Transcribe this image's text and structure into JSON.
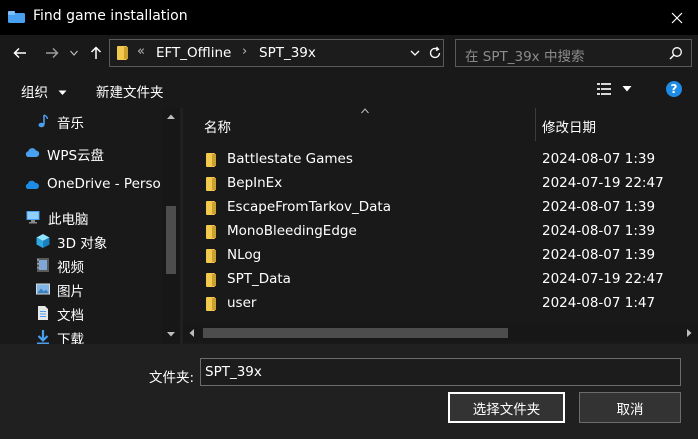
{
  "window": {
    "title": "Find game installation"
  },
  "address": {
    "overflow": "«",
    "segments": [
      "EFT_Offline",
      "SPT_39x"
    ]
  },
  "search": {
    "placeholder": "在 SPT_39x 中搜索"
  },
  "toolbar": {
    "organize": "组织",
    "new_folder": "新建文件夹"
  },
  "sidebar": {
    "items": [
      {
        "label": "音乐",
        "icon": "music-icon"
      },
      {
        "label": "WPS云盘",
        "icon": "cloud-icon"
      },
      {
        "label": "OneDrive - Perso",
        "icon": "onedrive-icon"
      },
      {
        "label": "此电脑",
        "icon": "computer-icon"
      },
      {
        "label": "3D 对象",
        "icon": "cube-icon"
      },
      {
        "label": "视频",
        "icon": "video-icon"
      },
      {
        "label": "图片",
        "icon": "picture-icon"
      },
      {
        "label": "文档",
        "icon": "document-icon"
      },
      {
        "label": "下载",
        "icon": "download-icon"
      }
    ]
  },
  "columns": {
    "name": "名称",
    "modified": "修改日期"
  },
  "files": [
    {
      "name": "Battlestate Games",
      "modified": "2024-08-07 1:39"
    },
    {
      "name": "BepInEx",
      "modified": "2024-07-19 22:47"
    },
    {
      "name": "EscapeFromTarkov_Data",
      "modified": "2024-08-07 1:39"
    },
    {
      "name": "MonoBleedingEdge",
      "modified": "2024-08-07 1:39"
    },
    {
      "name": "NLog",
      "modified": "2024-08-07 1:39"
    },
    {
      "name": "SPT_Data",
      "modified": "2024-07-19 22:47"
    },
    {
      "name": "user",
      "modified": "2024-08-07 1:47"
    }
  ],
  "footer": {
    "folder_label": "文件夹:",
    "folder_value": "SPT_39x",
    "select_button": "选择文件夹",
    "cancel_button": "取消"
  },
  "colors": {
    "folder": "#f2c94c",
    "help": "#1e8be6",
    "accent": "#4aa0f0"
  }
}
